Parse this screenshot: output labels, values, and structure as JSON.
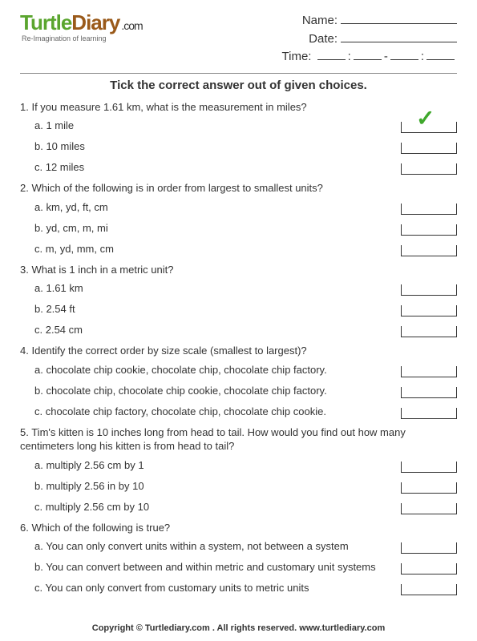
{
  "logo": {
    "word1": "Turtle",
    "word2": "Diary",
    "tld": ".com",
    "tagline": "Re-Imagination of learning"
  },
  "meta": {
    "name_label": "Name:",
    "date_label": "Date:",
    "time_label": "Time:",
    "colon": ":",
    "dash": "-"
  },
  "instruction": "Tick the correct answer out of given choices.",
  "questions": [
    {
      "num": "1.",
      "text": "If you measure 1.61 km, what is the measurement in miles?",
      "choices": [
        {
          "label": "a. 1 mile",
          "ticked": true
        },
        {
          "label": "b. 10 miles",
          "ticked": false
        },
        {
          "label": "c. 12 miles",
          "ticked": false
        }
      ]
    },
    {
      "num": "2.",
      "text": "Which of the following is in order from largest to smallest units?",
      "choices": [
        {
          "label": "a. km, yd, ft, cm",
          "ticked": false
        },
        {
          "label": "b. yd, cm, m, mi",
          "ticked": false
        },
        {
          "label": "c. m, yd, mm, cm",
          "ticked": false
        }
      ]
    },
    {
      "num": "3.",
      "text": "What is 1 inch in a metric unit?",
      "choices": [
        {
          "label": "a. 1.61 km",
          "ticked": false
        },
        {
          "label": "b. 2.54 ft",
          "ticked": false
        },
        {
          "label": "c. 2.54 cm",
          "ticked": false
        }
      ]
    },
    {
      "num": "4.",
      "text": "Identify the correct order by size scale (smallest to largest)?",
      "choices": [
        {
          "label": "a. chocolate chip cookie, chocolate chip, chocolate chip factory.",
          "ticked": false
        },
        {
          "label": "b. chocolate chip, chocolate chip cookie, chocolate chip factory.",
          "ticked": false
        },
        {
          "label": "c. chocolate chip factory, chocolate chip, chocolate chip cookie.",
          "ticked": false
        }
      ]
    },
    {
      "num": "5.",
      "text": "Tim's kitten is 10 inches long from head to tail. How would you find out how many centimeters long his kitten is from head to tail?",
      "choices": [
        {
          "label": "a. multiply 2.56 cm by 1",
          "ticked": false
        },
        {
          "label": "b. multiply 2.56 in by 10",
          "ticked": false
        },
        {
          "label": "c. multiply 2.56 cm by 10",
          "ticked": false
        }
      ]
    },
    {
      "num": "6.",
      "text": "Which of the following is true?",
      "choices": [
        {
          "label": "a. You can only convert units within a system, not between a system",
          "ticked": false
        },
        {
          "label": "b. You can convert between and within metric and customary unit systems",
          "ticked": false
        },
        {
          "label": "c. You can only convert from customary units to metric units",
          "ticked": false
        }
      ]
    }
  ],
  "footer": "Copyright © Turtlediary.com . All rights reserved. www.turtlediary.com"
}
